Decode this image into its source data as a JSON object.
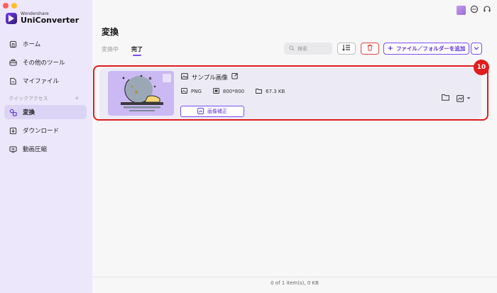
{
  "app": {
    "brand_small": "Wondershare",
    "brand_name": "UniConverter"
  },
  "sidebar": {
    "items": [
      {
        "label": "ホーム",
        "icon": "home-icon"
      },
      {
        "label": "その他のツール",
        "icon": "toolbox-icon"
      },
      {
        "label": "マイファイル",
        "icon": "file-icon"
      }
    ],
    "section_label": "クイックアクセス",
    "section_add": "+",
    "quick_items": [
      {
        "label": "変換",
        "icon": "convert-icon",
        "active": true
      },
      {
        "label": "ダウンロード",
        "icon": "download-icon"
      },
      {
        "label": "動画圧縮",
        "icon": "compress-icon"
      }
    ]
  },
  "main": {
    "title": "変換",
    "tabs": [
      "変換中",
      "完了"
    ],
    "active_tab": "完了",
    "search_placeholder": "検索",
    "add_button_label": "ファイル／フォルダーを追加"
  },
  "file": {
    "name": "サンプル画像",
    "format": "PNG",
    "resolution": "800*800",
    "size": "67.3 KB",
    "enhance_label": "画像補正"
  },
  "annotation": {
    "number": "10",
    "color": "#e01c1c"
  },
  "status": {
    "summary": "0 of 1 item(s), 0 KB"
  },
  "colors": {
    "accent": "#7a4cf3",
    "sidebar_bg": "#ede7fb",
    "delete": "#e0443a"
  }
}
